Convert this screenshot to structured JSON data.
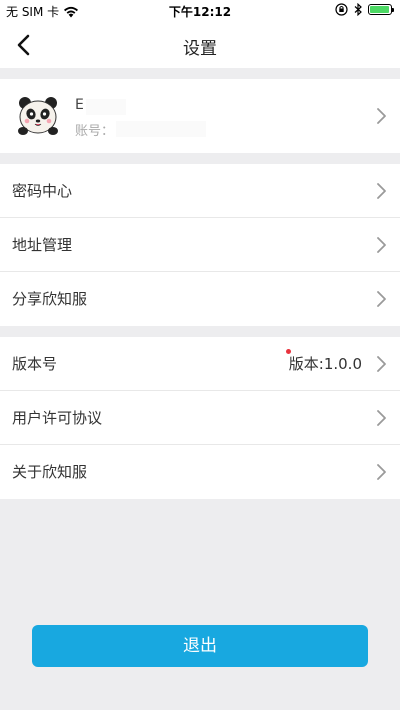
{
  "status_bar": {
    "carrier": "无 SIM 卡",
    "time": "下午12:12",
    "battery_level": 0.95,
    "icons": [
      "wifi-icon",
      "orientation-lock-icon",
      "bluetooth-icon",
      "battery-icon"
    ]
  },
  "nav": {
    "title": "设置",
    "back_icon": "chevron-left-icon"
  },
  "profile": {
    "name": "E",
    "account_label": "账号：",
    "account_value": "",
    "avatar_icon": "panda-avatar"
  },
  "group1": [
    {
      "label": "密码中心"
    },
    {
      "label": "地址管理"
    },
    {
      "label": "分享欣知服"
    }
  ],
  "group2": [
    {
      "label": "版本号",
      "value": "版本:1.0.0"
    },
    {
      "label": "用户许可协议"
    },
    {
      "label": "关于欣知服"
    }
  ],
  "logout_label": "退出",
  "colors": {
    "accent": "#18a8e0",
    "background": "#ededef",
    "battery": "#4cd964",
    "badge": "#e8333d"
  }
}
